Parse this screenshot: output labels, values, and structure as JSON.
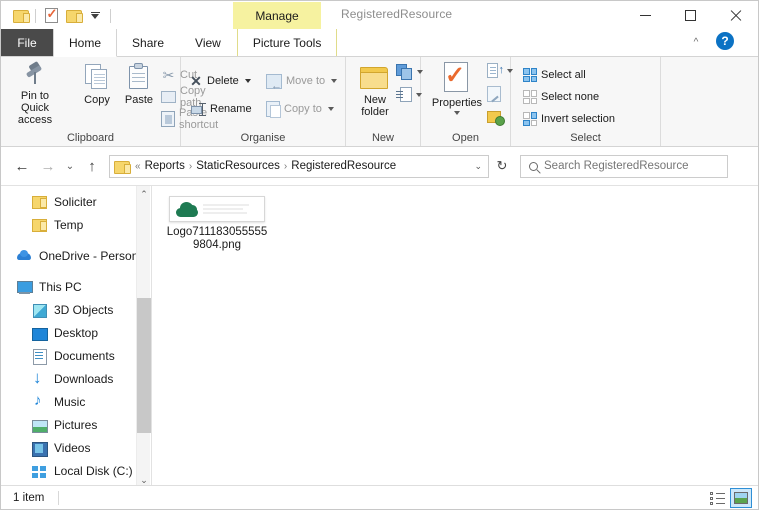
{
  "window": {
    "title": "RegisteredResource",
    "contextual_tab_header": "Manage",
    "minimize": "—",
    "maximize": "□",
    "close": "✕",
    "ribbon_collapse": "^",
    "help": "?"
  },
  "quick_access": {
    "items": [
      {
        "name": "folder-icon",
        "label": ""
      },
      {
        "name": "properties-icon",
        "label": ""
      },
      {
        "name": "new-folder-icon",
        "label": ""
      },
      {
        "name": "customize-dropdown",
        "label": ""
      }
    ]
  },
  "tabs": [
    {
      "id": "file",
      "label": "File"
    },
    {
      "id": "home",
      "label": "Home"
    },
    {
      "id": "share",
      "label": "Share"
    },
    {
      "id": "view",
      "label": "View"
    },
    {
      "id": "picture-tools",
      "label": "Picture Tools"
    }
  ],
  "ribbon": {
    "groups": [
      {
        "id": "clipboard",
        "label": "Clipboard",
        "big_buttons": [
          {
            "id": "pin-to-quick-access",
            "label": "Pin to Quick\naccess",
            "line1": "Pin to Quick",
            "line2": "access"
          },
          {
            "id": "copy",
            "label": "Copy"
          },
          {
            "id": "paste",
            "label": "Paste"
          }
        ],
        "small_buttons": [
          {
            "id": "cut",
            "label": "Cut",
            "enabled": false
          },
          {
            "id": "copy-path",
            "label": "Copy path",
            "enabled": false
          },
          {
            "id": "paste-shortcut",
            "label": "Paste shortcut",
            "enabled": false
          }
        ]
      },
      {
        "id": "organise",
        "label": "Organise",
        "small_buttons": [
          {
            "id": "move-to",
            "label": "Move to",
            "has_dropdown": true
          },
          {
            "id": "copy-to",
            "label": "Copy to",
            "has_dropdown": true
          },
          {
            "id": "delete",
            "label": "Delete",
            "has_dropdown": true
          },
          {
            "id": "rename",
            "label": "Rename",
            "has_dropdown": false
          }
        ]
      },
      {
        "id": "new",
        "label": "New",
        "big_buttons": [
          {
            "id": "new-folder",
            "label": "New folder",
            "line1": "New",
            "line2": "folder"
          }
        ],
        "small_buttons": [
          {
            "id": "new-item",
            "label": "",
            "has_dropdown": true
          },
          {
            "id": "easy-access",
            "label": "",
            "has_dropdown": true
          }
        ]
      },
      {
        "id": "open",
        "label": "Open",
        "big_buttons": [
          {
            "id": "properties",
            "label": "Properties",
            "line1": "Properties",
            "line2": ""
          }
        ],
        "small_buttons": [
          {
            "id": "open-with",
            "label": "",
            "has_dropdown": true
          },
          {
            "id": "edit",
            "label": "",
            "has_dropdown": false
          },
          {
            "id": "history",
            "label": "",
            "has_dropdown": false
          }
        ]
      },
      {
        "id": "select",
        "label": "Select",
        "small_buttons": [
          {
            "id": "select-all",
            "label": "Select all"
          },
          {
            "id": "select-none",
            "label": "Select none"
          },
          {
            "id": "invert-selection",
            "label": "Invert selection"
          }
        ]
      }
    ]
  },
  "address": {
    "back": "←",
    "forward": "→",
    "recent": "⌄",
    "up": "↑",
    "overflow": "«",
    "crumbs": [
      "Reports",
      "StaticResources",
      "RegisteredResource"
    ],
    "separator": "›",
    "dropdown": "⌄",
    "refresh": "↻"
  },
  "search": {
    "placeholder": "Search RegisteredResource",
    "value": ""
  },
  "nav_pane": {
    "items": [
      {
        "id": "soliciter",
        "label": "Soliciter",
        "icon": "folder-icon",
        "indent": 1
      },
      {
        "id": "temp",
        "label": "Temp",
        "icon": "folder-icon",
        "indent": 1
      },
      {
        "id": "onedrive-personal",
        "label": "OneDrive - Person",
        "icon": "cloud-icon",
        "indent": 0
      },
      {
        "id": "this-pc",
        "label": "This PC",
        "icon": "computer-icon",
        "indent": 0
      },
      {
        "id": "3d-objects",
        "label": "3D Objects",
        "icon": "3d-objects-icon",
        "indent": 1
      },
      {
        "id": "desktop",
        "label": "Desktop",
        "icon": "desktop-icon",
        "indent": 1
      },
      {
        "id": "documents",
        "label": "Documents",
        "icon": "documents-icon",
        "indent": 1
      },
      {
        "id": "downloads",
        "label": "Downloads",
        "icon": "downloads-icon",
        "indent": 1
      },
      {
        "id": "music",
        "label": "Music",
        "icon": "music-icon",
        "indent": 1
      },
      {
        "id": "pictures",
        "label": "Pictures",
        "icon": "pictures-icon",
        "indent": 1
      },
      {
        "id": "videos",
        "label": "Videos",
        "icon": "videos-icon",
        "indent": 1
      },
      {
        "id": "local-disk-c",
        "label": "Local Disk (C:)",
        "icon": "disk-icon",
        "indent": 1
      }
    ],
    "scroll_up": "⌃",
    "scroll_down": "⌄"
  },
  "files": [
    {
      "id": "logo-png",
      "name": "Logo7111830555559804.png",
      "thumbnail": "green-cloud-logo"
    }
  ],
  "status": {
    "item_count": "1 item"
  },
  "view_buttons": [
    {
      "id": "details-view",
      "label": "",
      "active": false
    },
    {
      "id": "large-icons-view",
      "label": "",
      "active": true
    }
  ],
  "colors": {
    "contextual_tab": "#f6f2a0",
    "file_tab": "#4a4a4a",
    "ribbon_bg": "#f7f7f7",
    "accent": "#0b72c4",
    "logo_green": "#1e7a52",
    "folder_yellow": "#f6d66c"
  }
}
